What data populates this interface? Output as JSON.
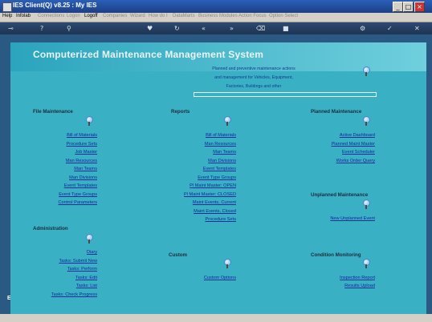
{
  "window": {
    "title": "IES Client(Q) v8.25 : My IES"
  },
  "menu": [
    {
      "label": "Help",
      "enabled": true
    },
    {
      "label": "Infolab",
      "enabled": true
    },
    {
      "label": "Connections",
      "enabled": false
    },
    {
      "label": "Logon",
      "enabled": false
    },
    {
      "label": "Logoff",
      "enabled": true
    },
    {
      "label": "Companies",
      "enabled": false
    },
    {
      "label": "Wizard",
      "enabled": false
    },
    {
      "label": "How do I",
      "enabled": false
    },
    {
      "label": "DataMarts",
      "enabled": false
    },
    {
      "label": "Business Modules",
      "enabled": false
    },
    {
      "label": "Action Focus",
      "enabled": false
    },
    {
      "label": "Option Select",
      "enabled": false
    }
  ],
  "toolbar": {
    "icons": [
      "key-icon",
      "help-icon",
      "search-icon",
      "heart-icon",
      "refresh-icon",
      "rewind-icon",
      "fast-forward-icon",
      "delete-icon",
      "stop-icon",
      "settings-icon",
      "check-icon",
      "close-icon"
    ]
  },
  "header": {
    "title": "Computerized Maintenance Management System"
  },
  "description": {
    "line1": "Planned and preventive maintenance actions",
    "line2": "and management for Vehicles, Equipment,",
    "line3": "Factories, Buildings and other"
  },
  "sections": {
    "file_maintenance": {
      "title": "File Maintenance",
      "links": [
        "Bill of Materials",
        "Procedure Sets",
        "Job Master",
        "Man Resources",
        "Man Teams",
        "Man Divisions",
        "Event Templates",
        "Event Type Groups",
        "Control Parameters"
      ]
    },
    "reports": {
      "title": "Reports",
      "links": [
        "Bill of Materials",
        "Man Resources",
        "Man Teams",
        "Man Divisions",
        "Event Templates",
        "Event Type Groups",
        "Pl Maint Master: OPEN",
        "Pl Maint Master: CLOSED",
        "Maint Events, Current",
        "Maint Events, Closed",
        "Procedure Sets"
      ]
    },
    "planned": {
      "title": "Planned Maintenance",
      "links": [
        "Active Dashboard",
        "Planned Maint Master",
        "Event Scheduler",
        "Works Order Query"
      ]
    },
    "unplanned": {
      "title": "Unplanned Maintenance",
      "links": [
        "New Unplanned Event"
      ]
    },
    "administration": {
      "title": "Administration",
      "links": [
        "Diary",
        "Tasks: Submit New",
        "Tasks: Perform",
        "Tasks: Edit",
        "Tasks: List",
        "Tasks: Check Progress"
      ]
    },
    "custom": {
      "title": "Custom",
      "links": [
        "Custom Options"
      ]
    },
    "condition": {
      "title": "Condition Monitoring",
      "links": [
        "Inspection Report",
        "Results Upload"
      ]
    }
  },
  "side_letter": "E",
  "colors": {
    "panel": "#3ab0c4",
    "link": "#0f2a9a",
    "frame": "#2a5a84"
  }
}
